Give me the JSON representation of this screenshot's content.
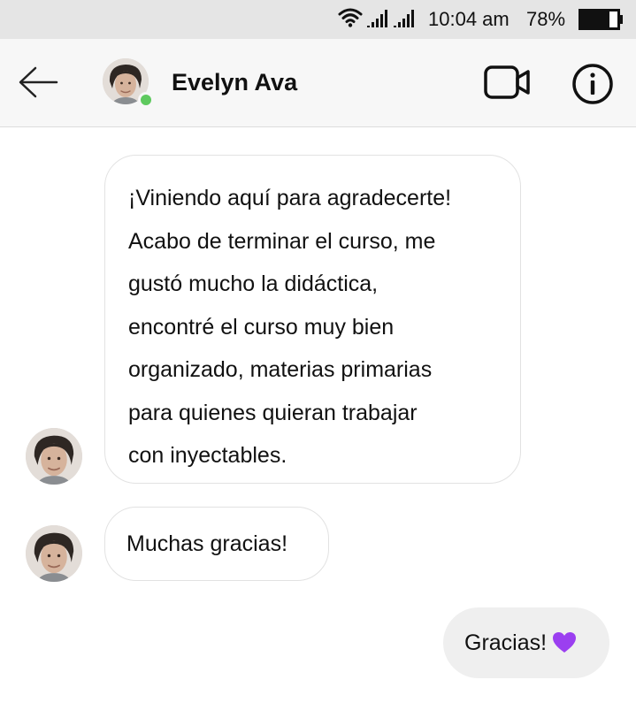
{
  "status_bar": {
    "time": "10:04 am",
    "battery_percent": "78%",
    "battery_level": 0.78,
    "icons": [
      "wifi-icon",
      "signal-icon",
      "signal-icon",
      "battery-icon"
    ]
  },
  "header": {
    "contact_name": "Evelyn Ava",
    "online": true,
    "online_color": "#5ec95e",
    "icons": [
      "back-arrow-icon",
      "video-camera-icon",
      "info-icon"
    ]
  },
  "messages": [
    {
      "direction": "incoming",
      "lines": [
        "¡Viniendo aquí para agradecerte!",
        "Acabo de terminar el curso, me",
        "gustó mucho la didáctica,",
        "encontré el curso muy bien",
        "organizado, materias primarias",
        "para quienes quieran trabajar",
        "con inyectables."
      ]
    },
    {
      "direction": "incoming",
      "text": "Muchas gracias!"
    },
    {
      "direction": "outgoing",
      "text": "Gracias!",
      "emoji": "purple-heart-icon",
      "emoji_color": "#9b3ff0"
    }
  ]
}
